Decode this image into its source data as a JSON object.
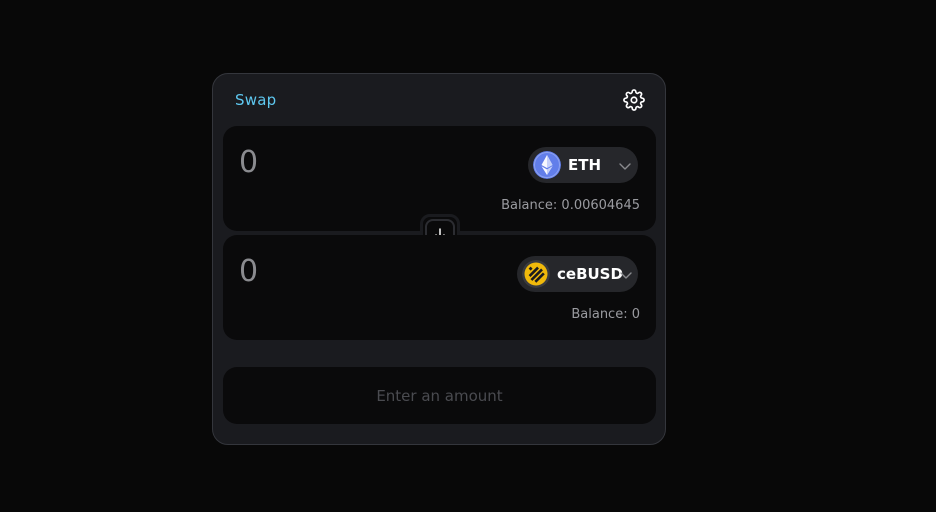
{
  "header": {
    "title": "Swap",
    "settings_icon": "gear-icon"
  },
  "from": {
    "amount": "0",
    "token": {
      "symbol": "ETH",
      "icon": "ethereum-logo-icon",
      "color": "#627eea"
    },
    "balance": "Balance: 0.00604645"
  },
  "to": {
    "amount": "0",
    "token": {
      "symbol": "ceBUSD",
      "icon": "busd-logo-icon",
      "color": "#f0b90b"
    },
    "balance": "Balance: 0"
  },
  "switch": {
    "icon": "arrow-down-icon"
  },
  "submit": {
    "label": "Enter an amount"
  },
  "colors": {
    "accent": "#5ec8f0",
    "background": "#080808",
    "card": "#1a1b1f",
    "panel": "#0a0a0b"
  }
}
